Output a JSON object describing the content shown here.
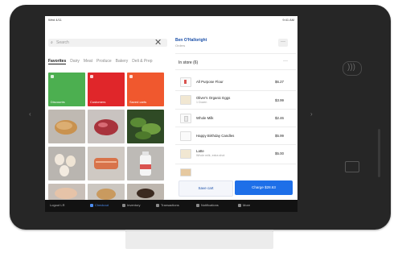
{
  "status_bar": {
    "left": "Wed 4/11",
    "right": "9:41 AM"
  },
  "search": {
    "placeholder": "Search",
    "close_glyph": "✕"
  },
  "categories": [
    "Favorites",
    "Dairy",
    "Meat",
    "Produce",
    "Bakery",
    "Deli & Prep"
  ],
  "tiles": [
    {
      "label": "Discounts",
      "color": "#4caf50"
    },
    {
      "label": "Customers",
      "color": "#e0262a"
    },
    {
      "label": "Saved carts",
      "color": "#f0582e"
    }
  ],
  "customer": {
    "name": "Ben O'Halloright",
    "sub": "Orders"
  },
  "cart": {
    "header": "In store (6)",
    "items": [
      {
        "name": "All Purpose Flour",
        "sub": "",
        "price": "$6.27",
        "icon": "flour-icon"
      },
      {
        "name": "Oliver's Organic Eggs",
        "sub": "1 Dozen",
        "price": "$3.99",
        "icon": "eggs-icon"
      },
      {
        "name": "Whole Milk",
        "sub": "",
        "price": "$2.46",
        "icon": "milk-icon"
      },
      {
        "name": "Happy Birthday Candles",
        "sub": "",
        "price": "$5.99",
        "icon": "candles-icon"
      },
      {
        "name": "Latte",
        "sub": "Whole milk, extra shot",
        "price": "$5.00",
        "icon": "latte-icon"
      }
    ],
    "save_label": "Save cart",
    "charge_label": "Charge $28.63"
  },
  "nav": [
    {
      "label": "Logout LR",
      "active": false
    },
    {
      "label": "Checkout",
      "active": true
    },
    {
      "label": "Inventory",
      "active": false
    },
    {
      "label": "Transactions",
      "active": false
    },
    {
      "label": "Notifications",
      "active": false
    },
    {
      "label": "More",
      "active": false
    }
  ],
  "colors": {
    "accent": "#1e6fe8",
    "link": "#1a4fa8",
    "nav_bg": "#121212"
  }
}
